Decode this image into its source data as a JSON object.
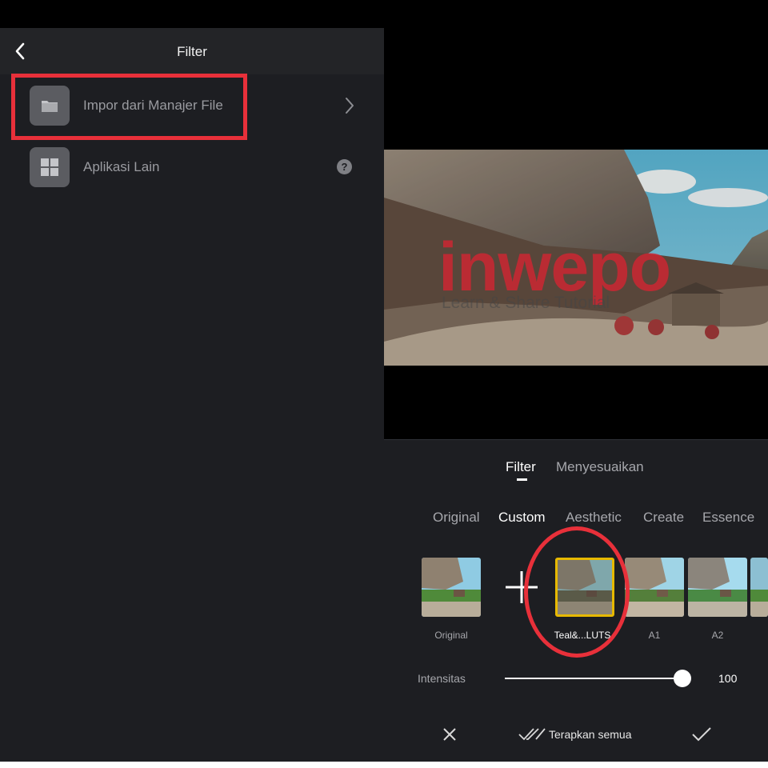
{
  "left": {
    "header": {
      "title": "Filter"
    },
    "items": [
      {
        "label": "Impor dari Manajer File"
      },
      {
        "label": "Aplikasi Lain"
      }
    ],
    "help_glyph": "?"
  },
  "preview": {
    "watermark_title": "inwepo",
    "watermark_subtitle": "Learn & Share Tutorial"
  },
  "editor": {
    "tabs": [
      {
        "label": "Filter",
        "active": true
      },
      {
        "label": "Menyesuaikan",
        "active": false
      }
    ],
    "categories": [
      {
        "label": "Original",
        "active": false
      },
      {
        "label": "Custom",
        "active": true
      },
      {
        "label": "Aesthetic",
        "active": false
      },
      {
        "label": "Create",
        "active": false
      },
      {
        "label": "Essence",
        "active": false
      }
    ],
    "filters": [
      {
        "label": "Original"
      },
      {
        "label": "Teal&...LUTS",
        "selected": true
      },
      {
        "label": "A1"
      },
      {
        "label": "A2"
      }
    ],
    "intensity": {
      "label": "Intensitas",
      "value": "100",
      "fraction": 1.0
    },
    "apply_all_label": "Terapkan semua"
  },
  "colors": {
    "highlight_red": "#e8303a",
    "selected_yellow": "#e7b900",
    "panel_dark": "#1d1e22"
  },
  "icons": [
    "back-arrow-icon",
    "folder-icon",
    "apps-grid-icon",
    "chevron-right-icon",
    "help-icon",
    "plus-icon",
    "close-icon",
    "double-check-icon",
    "check-icon"
  ]
}
